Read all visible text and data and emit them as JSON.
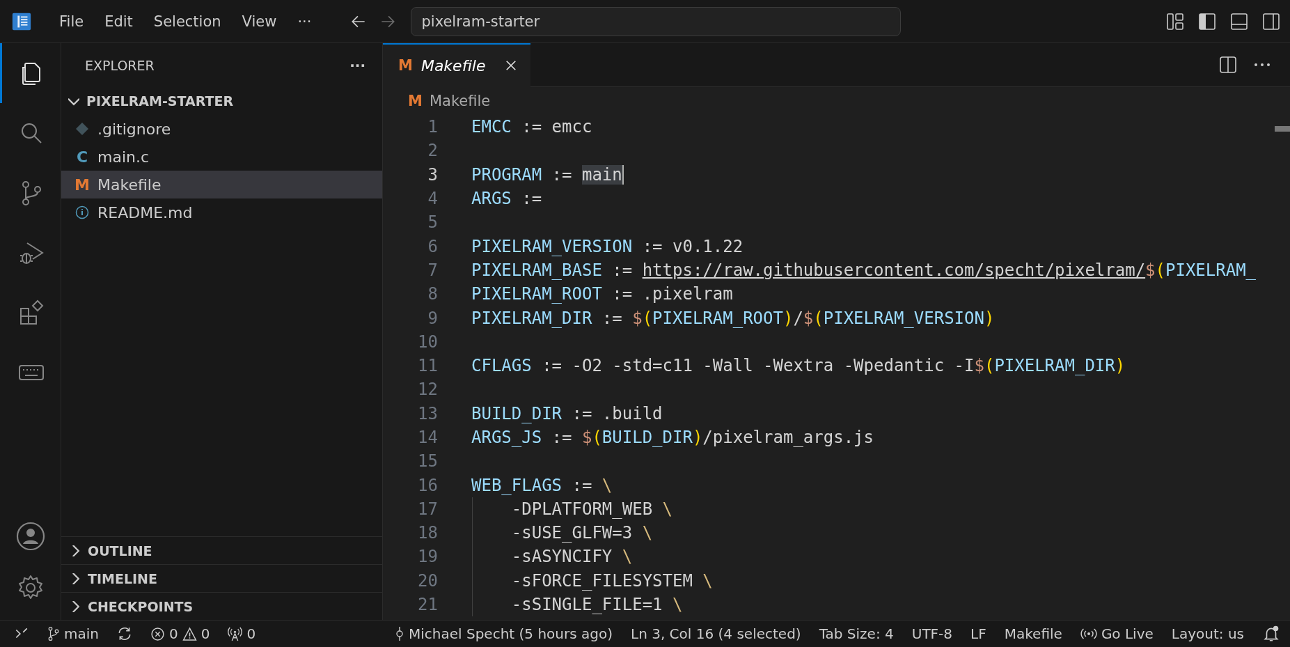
{
  "menu": [
    "File",
    "Edit",
    "Selection",
    "View",
    "···"
  ],
  "search": {
    "value": "pixelram-starter"
  },
  "activity": [
    {
      "kind": "files",
      "selected": true
    },
    {
      "kind": "search",
      "selected": false
    },
    {
      "kind": "git",
      "selected": false
    },
    {
      "kind": "debug",
      "selected": false
    },
    {
      "kind": "extensions",
      "selected": false
    },
    {
      "kind": "keyboard",
      "selected": false
    }
  ],
  "sidebar": {
    "title": "EXPLORER",
    "more": "···",
    "project": {
      "name": "PIXELRAM-STARTER",
      "expanded": true
    },
    "files": [
      {
        "name": ".gitignore",
        "kind": "git",
        "selected": false
      },
      {
        "name": "main.c",
        "kind": "c",
        "badge": "C",
        "selected": false
      },
      {
        "name": "Makefile",
        "kind": "make",
        "badge": "M",
        "selected": true
      },
      {
        "name": "README.md",
        "kind": "info",
        "selected": false
      }
    ],
    "sections": [
      {
        "name": "OUTLINE",
        "expanded": false
      },
      {
        "name": "TIMELINE",
        "expanded": false
      },
      {
        "name": "CHECKPOINTS",
        "expanded": false
      }
    ]
  },
  "tabs": [
    {
      "label": "Makefile",
      "badge": "M",
      "selected": true,
      "preview": true
    }
  ],
  "breadcrumb": {
    "badge": "M",
    "label": "Makefile"
  },
  "lines": [
    {
      "number": "1",
      "current": false,
      "guide": false,
      "tokens": [
        {
          "text": "EMCC",
          "kind": "var"
        },
        {
          "text": " := emcc",
          "kind": "plain"
        }
      ]
    },
    {
      "number": "2",
      "current": false,
      "guide": false
    },
    {
      "number": "3",
      "current": true,
      "guide": false,
      "tokens": [
        {
          "text": "PROGRAM",
          "kind": "var"
        },
        {
          "text": " := ",
          "kind": "plain"
        },
        {
          "text": "main",
          "kind": "selected"
        }
      ]
    },
    {
      "number": "4",
      "current": false,
      "guide": false,
      "tokens": [
        {
          "text": "ARGS",
          "kind": "var"
        },
        {
          "text": " :=",
          "kind": "plain"
        }
      ]
    },
    {
      "number": "5",
      "current": false,
      "guide": false
    },
    {
      "number": "6",
      "current": false,
      "guide": false,
      "tokens": [
        {
          "text": "PIXELRAM_VERSION",
          "kind": "var"
        },
        {
          "text": " := v0.1.22",
          "kind": "plain"
        }
      ]
    },
    {
      "number": "7",
      "current": false,
      "guide": false,
      "tokens": [
        {
          "text": "PIXELRAM_BASE",
          "kind": "var"
        },
        {
          "text": " := ",
          "kind": "plain"
        },
        {
          "text": "https://raw.githubusercontent.com/specht/pixelram/",
          "kind": "link"
        },
        {
          "text": "$",
          "kind": "dollar"
        },
        {
          "text": "(",
          "kind": "paren"
        },
        {
          "text": "PIXELRAM_",
          "kind": "var"
        }
      ]
    },
    {
      "number": "8",
      "current": false,
      "guide": false,
      "tokens": [
        {
          "text": "PIXELRAM_ROOT",
          "kind": "var"
        },
        {
          "text": " := .pixelram",
          "kind": "plain"
        }
      ]
    },
    {
      "number": "9",
      "current": false,
      "guide": false,
      "tokens": [
        {
          "text": "PIXELRAM_DIR",
          "kind": "var"
        },
        {
          "text": " := ",
          "kind": "plain"
        },
        {
          "text": "$",
          "kind": "dollar"
        },
        {
          "text": "(",
          "kind": "paren"
        },
        {
          "text": "PIXELRAM_ROOT",
          "kind": "var"
        },
        {
          "text": ")",
          "kind": "paren"
        },
        {
          "text": "/",
          "kind": "plain"
        },
        {
          "text": "$",
          "kind": "dollar"
        },
        {
          "text": "(",
          "kind": "paren"
        },
        {
          "text": "PIXELRAM_VERSION",
          "kind": "var"
        },
        {
          "text": ")",
          "kind": "paren"
        }
      ]
    },
    {
      "number": "10",
      "current": false,
      "guide": false
    },
    {
      "number": "11",
      "current": false,
      "guide": false,
      "tokens": [
        {
          "text": "CFLAGS",
          "kind": "var"
        },
        {
          "text": " := -O2 -std=c11 -Wall -Wextra -Wpedantic -I",
          "kind": "plain"
        },
        {
          "text": "$",
          "kind": "dollar"
        },
        {
          "text": "(",
          "kind": "paren"
        },
        {
          "text": "PIXELRAM_DIR",
          "kind": "var"
        },
        {
          "text": ")",
          "kind": "paren"
        }
      ]
    },
    {
      "number": "12",
      "current": false,
      "guide": false
    },
    {
      "number": "13",
      "current": false,
      "guide": false,
      "tokens": [
        {
          "text": "BUILD_DIR",
          "kind": "var"
        },
        {
          "text": " := .build",
          "kind": "plain"
        }
      ]
    },
    {
      "number": "14",
      "current": false,
      "guide": false,
      "tokens": [
        {
          "text": "ARGS_JS",
          "kind": "var"
        },
        {
          "text": " := ",
          "kind": "plain"
        },
        {
          "text": "$",
          "kind": "dollar"
        },
        {
          "text": "(",
          "kind": "paren"
        },
        {
          "text": "BUILD_DIR",
          "kind": "var"
        },
        {
          "text": ")",
          "kind": "paren"
        },
        {
          "text": "/pixelram_args.js",
          "kind": "plain"
        }
      ]
    },
    {
      "number": "15",
      "current": false,
      "guide": false
    },
    {
      "number": "16",
      "current": false,
      "guide": false,
      "tokens": [
        {
          "text": "WEB_FLAGS",
          "kind": "var"
        },
        {
          "text": " := ",
          "kind": "plain"
        },
        {
          "text": "\\",
          "kind": "cont"
        }
      ]
    },
    {
      "number": "17",
      "current": false,
      "guide": true,
      "tokens": [
        {
          "text": "    -DPLATFORM_WEB ",
          "kind": "plain"
        },
        {
          "text": "\\",
          "kind": "cont"
        }
      ]
    },
    {
      "number": "18",
      "current": false,
      "guide": true,
      "tokens": [
        {
          "text": "    -sUSE_GLFW=3 ",
          "kind": "plain"
        },
        {
          "text": "\\",
          "kind": "cont"
        }
      ]
    },
    {
      "number": "19",
      "current": false,
      "guide": true,
      "tokens": [
        {
          "text": "    -sASYNCIFY ",
          "kind": "plain"
        },
        {
          "text": "\\",
          "kind": "cont"
        }
      ]
    },
    {
      "number": "20",
      "current": false,
      "guide": true,
      "tokens": [
        {
          "text": "    -sFORCE_FILESYSTEM ",
          "kind": "plain"
        },
        {
          "text": "\\",
          "kind": "cont"
        }
      ]
    },
    {
      "number": "21",
      "current": false,
      "guide": true,
      "tokens": [
        {
          "text": "    -sSINGLE_FILE=1 ",
          "kind": "plain"
        },
        {
          "text": "\\",
          "kind": "cont"
        }
      ]
    }
  ],
  "status_bar": {
    "branch": "main",
    "errors": "0",
    "warnings": "0",
    "ports": "0",
    "blame": "Michael Specht (5 hours ago)",
    "right": [
      {
        "kind": "text",
        "label": "Ln 3, Col 16 (4 selected)"
      },
      {
        "kind": "text",
        "label": "Tab Size: 4"
      },
      {
        "kind": "text",
        "label": "UTF-8"
      },
      {
        "kind": "text",
        "label": "LF"
      },
      {
        "kind": "text",
        "label": "Makefile"
      },
      {
        "kind": "live",
        "label": "Go Live"
      },
      {
        "kind": "text",
        "label": "Layout: us"
      }
    ]
  }
}
